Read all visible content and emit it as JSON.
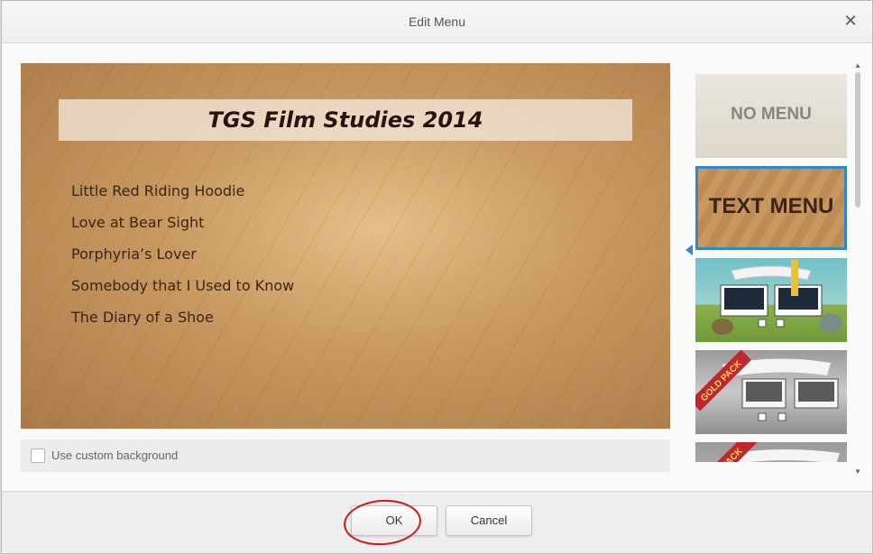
{
  "dialog": {
    "title": "Edit Menu",
    "close_icon": "close-icon"
  },
  "preview": {
    "title": "TGS Film Studies 2014",
    "items": [
      "Little Red Riding Hoodie",
      "Love at Bear Sight",
      "Porphyria’s Lover",
      "Somebody that I Used to Know",
      "The Diary of a Shoe"
    ]
  },
  "options": {
    "custom_background_label": "Use custom background",
    "custom_background_checked": false
  },
  "thumbnails": {
    "no_menu_label": "NO MENU",
    "text_menu_label": "TEXT MENU",
    "gold_pack_label": "GOLD PACK",
    "pack_label": "PACK",
    "selected": "TEXT MENU"
  },
  "buttons": {
    "ok": "OK",
    "cancel": "Cancel"
  },
  "colors": {
    "accent": "#2f88c8",
    "annotation": "#d01818",
    "wood": "#c4965e"
  }
}
